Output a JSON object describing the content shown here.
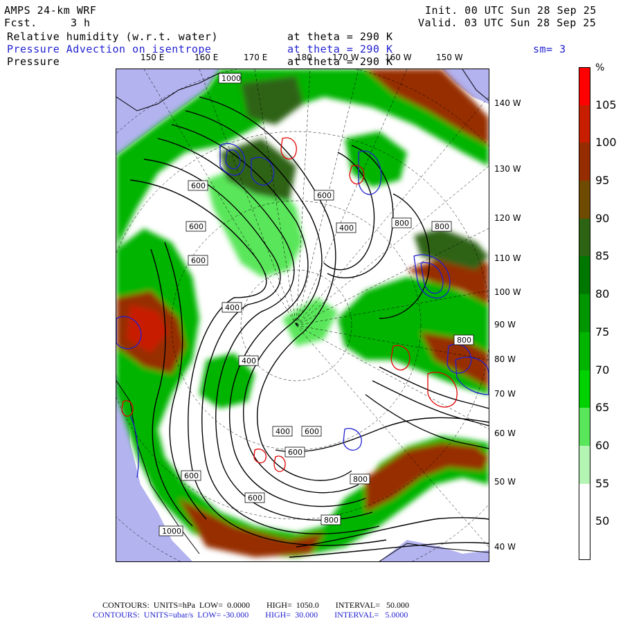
{
  "header": {
    "model": "AMPS 24-km WRF",
    "fcst_label": "Fcst.",
    "fcst_value": "3 h",
    "init": "Init. 00 UTC Sun 28 Sep 25",
    "valid": "Valid. 03 UTC Sun 28 Sep 25",
    "field1_name": "Relative humidity (w.r.t. water)",
    "field1_level": "at theta = 290 K",
    "field2_name": "Pressure Advection on isentrope",
    "field2_level": "at theta = 290 K",
    "field2_smooth": "sm= 3",
    "field3_name": "Pressure",
    "field3_level": "at theta = 290 K"
  },
  "lon_labels_top": [
    "150 E",
    "160 E",
    "170 E",
    "180",
    "170 W",
    "160 W",
    "150 W"
  ],
  "lat_labels_right": [
    "140 W",
    "130 W",
    "120 W",
    "110 W",
    "100 W",
    "90 W",
    "80 W",
    "70 W",
    "60 W",
    "50 W",
    "40 W"
  ],
  "colorbar": {
    "unit": "%",
    "labels": [
      "105",
      "100",
      "95",
      "90",
      "85",
      "80",
      "75",
      "70",
      "65",
      "60",
      "55",
      "50"
    ],
    "colors": [
      "#ff0000",
      "#c81e00",
      "#962d00",
      "#6e4b00",
      "#2d6414",
      "#007800",
      "#009600",
      "#00b400",
      "#00d200",
      "#5ae65a",
      "#b4f5b4",
      "#ffffff",
      "#ffffff"
    ]
  },
  "contour_labels": [
    "1000",
    "600",
    "600",
    "600",
    "600",
    "400",
    "400",
    "400",
    "400",
    "600",
    "800",
    "800",
    "800",
    "400",
    "600",
    "600",
    "800",
    "600",
    "1000",
    "800"
  ],
  "footer": {
    "line1": "CONTOURS:  UNITS=hPa  LOW=  0.0000        HIGH=  1050.0        INTERVAL=   50.000",
    "line2": "CONTOURS:  UNITS=ubar/s  LOW= -30.000        HIGH=  30.000        INTERVAL=   5.0000"
  },
  "colors": {
    "ocean": "#b3b3f0",
    "rh_light_green": "#5ae65a",
    "rh_green": "#00b400",
    "rh_dark_green": "#2d6414",
    "rh_brown": "#962d00",
    "rh_red": "#ff0000",
    "advection_blue": "#1f1fd0",
    "advection_red": "#e00000"
  }
}
